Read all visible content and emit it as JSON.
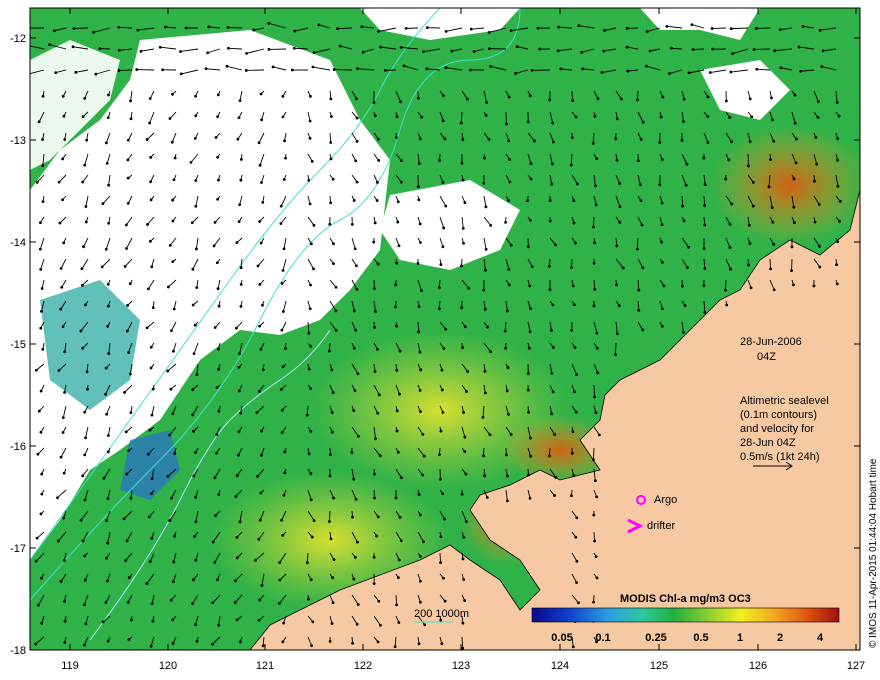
{
  "map": {
    "x_ticks": [
      "119",
      "120",
      "121",
      "122",
      "123",
      "124",
      "125",
      "126",
      "127"
    ],
    "y_ticks": [
      "-12",
      "-13",
      "-14",
      "-15",
      "-16",
      "-17",
      "-18"
    ],
    "date": "28-Jun-2006",
    "time": "04Z",
    "legend_lines": [
      "Altimetric sealevel",
      "(0.1m contours)",
      "and velocity for",
      "28-Jun 04Z",
      "0.5m/s (1kt 24h)"
    ],
    "argo_label": "Argo",
    "drifter_label": "drifter",
    "bathy_label": "200  1000m",
    "colorbar_title": "MODIS Chl-a mg/m3 OC3",
    "colorbar_labels": [
      "0.05",
      "0.1",
      "0.25",
      "0.5",
      "1",
      "2",
      "4"
    ],
    "credit": "© IMOS 11-Apr-2015 01:44:04 Hobart time",
    "colors": {
      "land": "#f6c9a2",
      "argo": "#ff00ff",
      "drifter": "#ff00ff",
      "contour": "#40e0d0"
    }
  }
}
